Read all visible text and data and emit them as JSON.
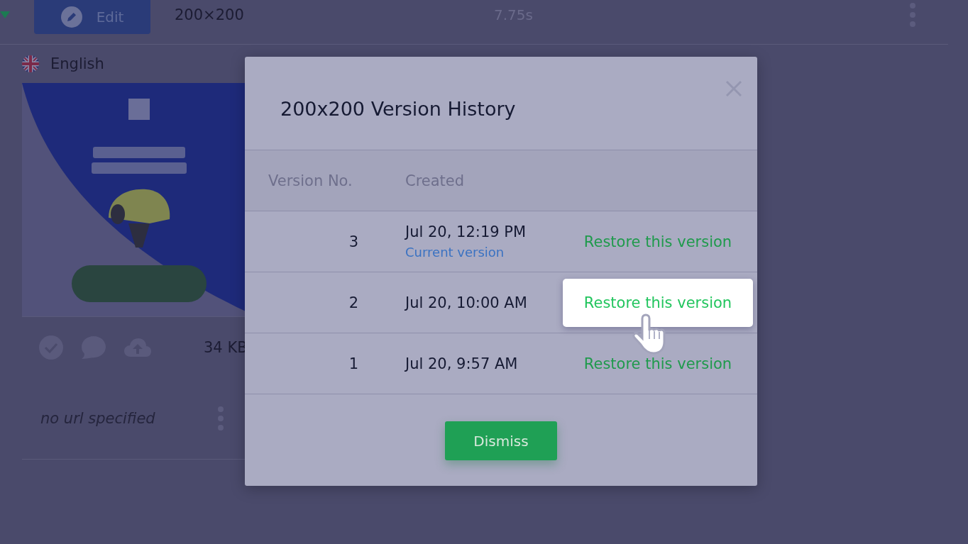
{
  "item": {
    "edit_button": "Edit",
    "size": "200×200",
    "duration": "7.75s",
    "language": "English",
    "file_size": "34 KB",
    "url": "no url specified"
  },
  "modal": {
    "title": "200x200 Version History",
    "columns": [
      "Version No.",
      "Created"
    ],
    "rows": [
      {
        "version": "3",
        "created": "Jul 20, 12:19 PM",
        "note": "Current version",
        "action": "Restore this version",
        "hovered": false
      },
      {
        "version": "2",
        "created": "Jul 20, 10:00 AM",
        "action": "Restore this version",
        "hovered": true
      },
      {
        "version": "1",
        "created": "Jul 20, 9:57 AM",
        "action": "Restore this version",
        "hovered": false
      }
    ],
    "dismiss": "Dismiss"
  }
}
